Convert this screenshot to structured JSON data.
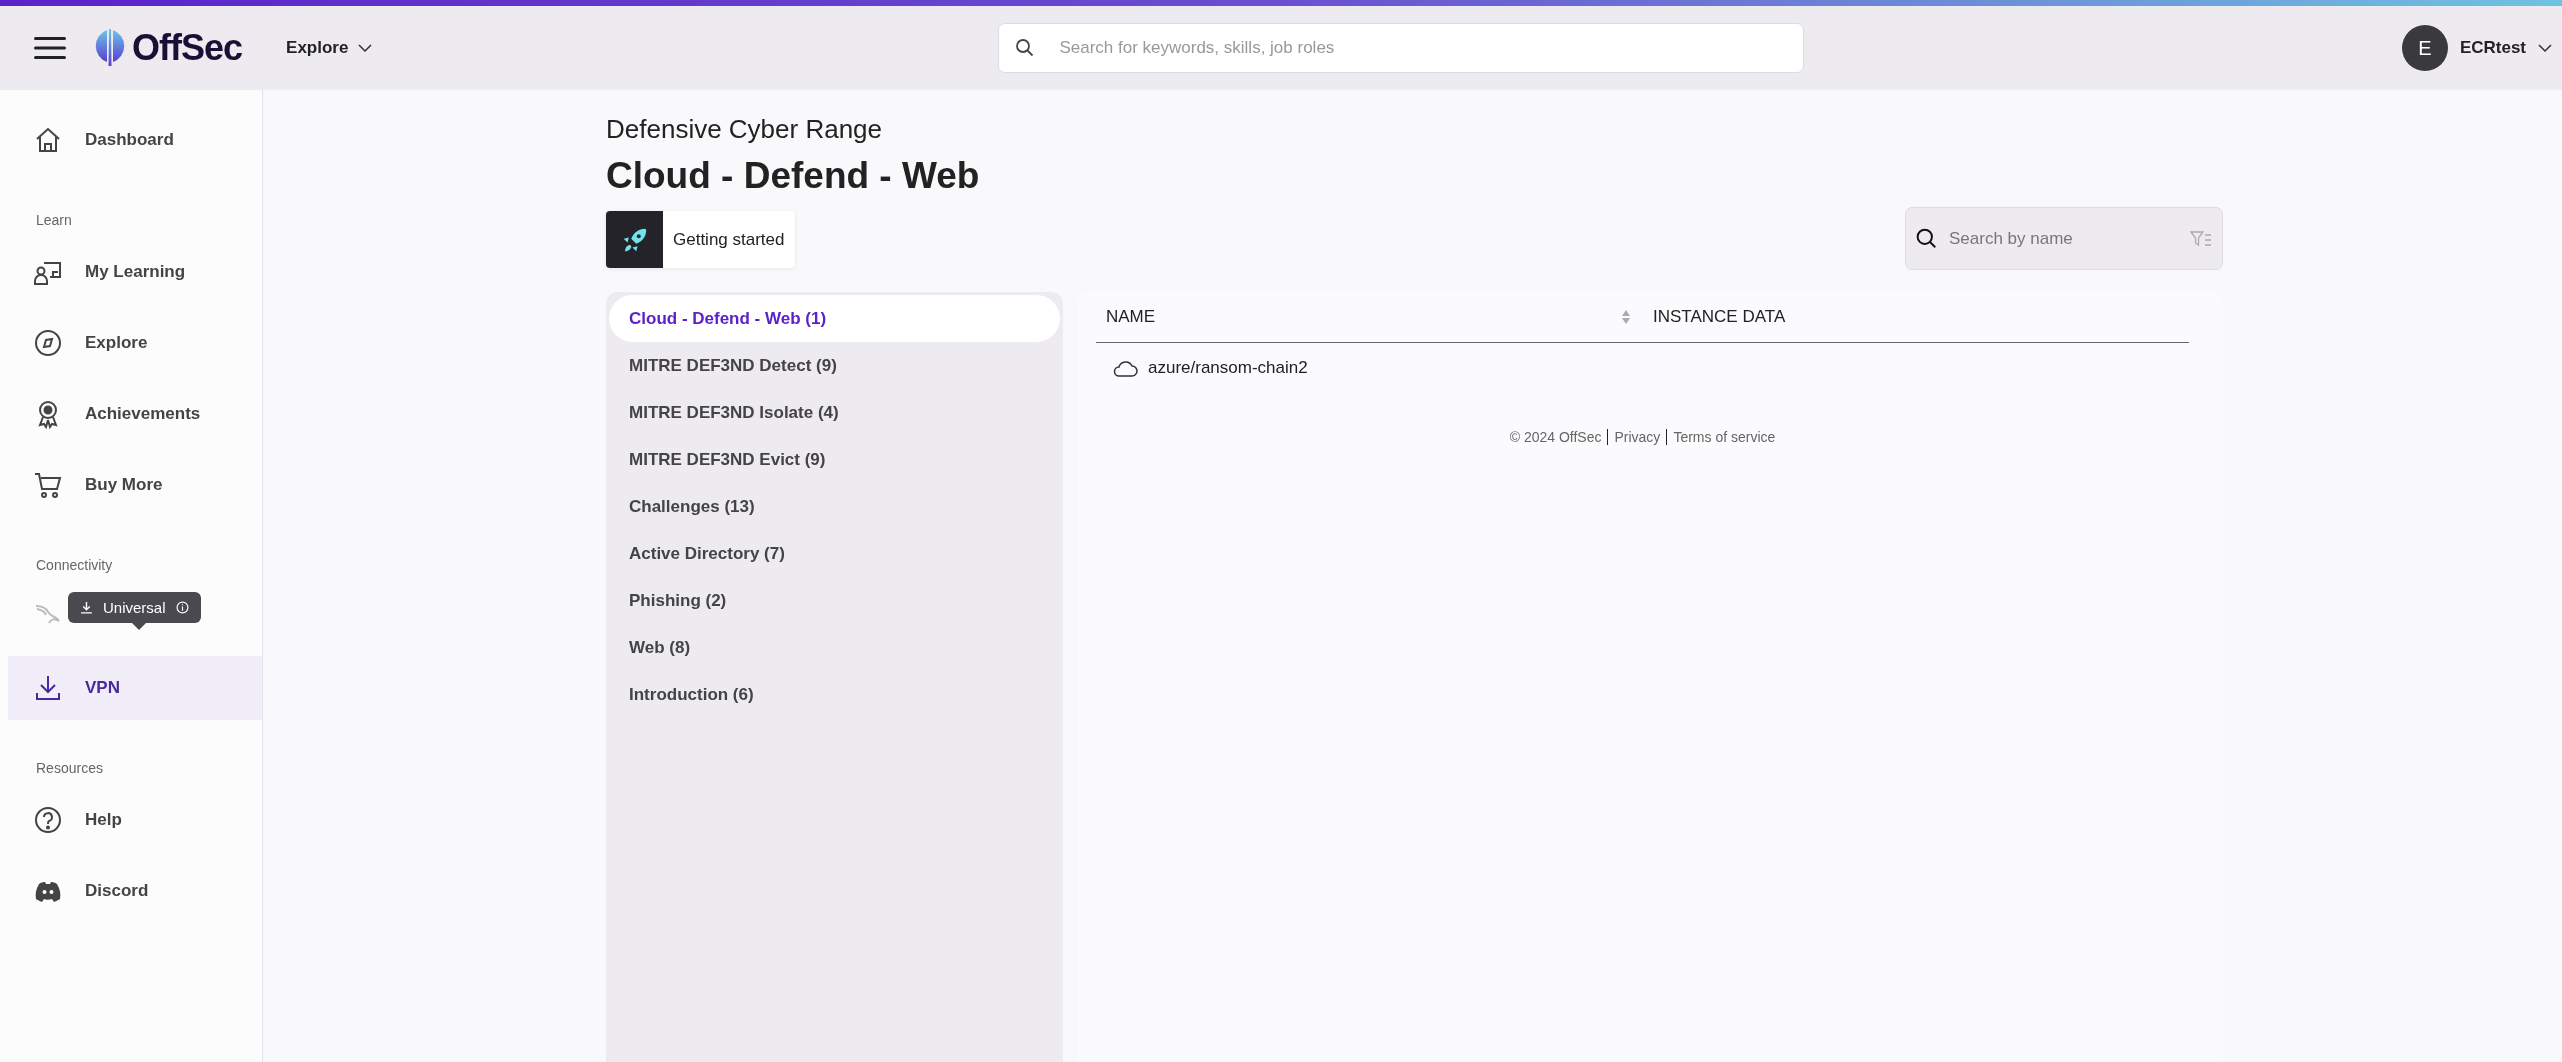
{
  "header": {
    "brand": "OffSec",
    "explore": "Explore",
    "search": {
      "placeholder": "Search for keywords, skills, job roles"
    },
    "user": {
      "initial": "E",
      "name": "ECRtest"
    }
  },
  "sidebar": {
    "sections": [
      {
        "items": [
          {
            "label": "Dashboard",
            "selected": false
          }
        ]
      },
      {
        "title": "Learn",
        "items": [
          {
            "label": "My Learning",
            "selected": false
          },
          {
            "label": "Explore",
            "selected": false
          },
          {
            "label": "Achievements",
            "selected": false
          },
          {
            "label": "Buy More",
            "selected": false
          }
        ]
      },
      {
        "title": "Connectivity",
        "items": [
          {
            "kind": "tooltip",
            "tooltip": "Universal",
            "selected": false
          },
          {
            "label": "VPN",
            "selected": true
          }
        ]
      },
      {
        "title": "Resources",
        "items": [
          {
            "label": "Help",
            "selected": false
          },
          {
            "label": "Discord",
            "selected": false
          }
        ]
      }
    ]
  },
  "page": {
    "kicker": "Defensive Cyber Range",
    "title": "Cloud - Defend - Web",
    "getting_started": "Getting started",
    "search": {
      "placeholder": "Search by name"
    }
  },
  "categories": [
    {
      "label": "Cloud - Defend - Web (1)",
      "selected": true
    },
    {
      "label": "MITRE DEF3ND Detect (9)",
      "selected": false
    },
    {
      "label": "MITRE DEF3ND Isolate (4)",
      "selected": false
    },
    {
      "label": "MITRE DEF3ND Evict (9)",
      "selected": false
    },
    {
      "label": "Challenges (13)",
      "selected": false
    },
    {
      "label": "Active Directory (7)",
      "selected": false
    },
    {
      "label": "Phishing (2)",
      "selected": false
    },
    {
      "label": "Web (8)",
      "selected": false
    },
    {
      "label": "Introduction (6)",
      "selected": false
    }
  ],
  "table": {
    "columns": [
      "NAME",
      "INSTANCE DATA"
    ],
    "rows": [
      {
        "name": "azure/ransom-chain2"
      }
    ]
  },
  "footer": {
    "copyright": "© 2024  OffSec",
    "links": [
      "Privacy",
      "Terms of service"
    ]
  }
}
